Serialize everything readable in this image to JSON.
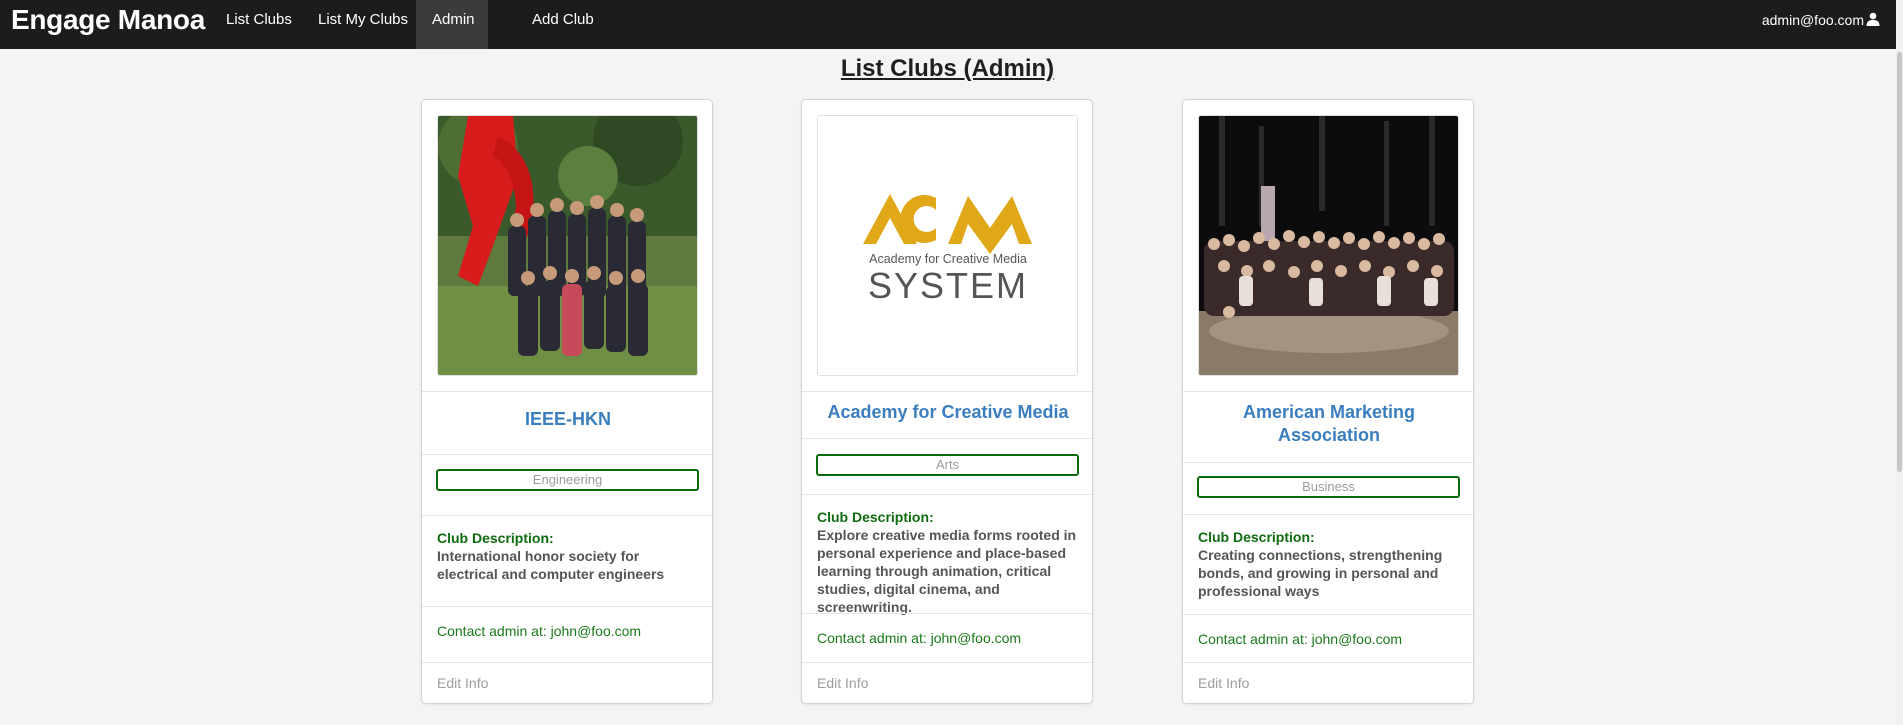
{
  "nav": {
    "brand": "Engage Manoa",
    "items": [
      {
        "label": "List Clubs",
        "active": false
      },
      {
        "label": "List My Clubs",
        "active": false
      },
      {
        "label": "Admin",
        "active": true
      },
      {
        "label": "Add Club",
        "active": false
      }
    ],
    "user": "admin@foo.com",
    "user_icon": "user-icon"
  },
  "page_title": "List Clubs (Admin)",
  "cards": [
    {
      "title": "IEEE-HKN",
      "image": "group-photo-red-sculpture",
      "tag": "Engineering",
      "desc_label": "Club Description:",
      "desc": "International honor society for electrical and computer engineers",
      "contact": "Contact admin at: john@foo.com",
      "edit": "Edit Info"
    },
    {
      "title": "Academy for Creative Media",
      "image": "acm-logo",
      "logo_text_top": "Academy for Creative Media",
      "logo_text_bottom": "SYSTEM",
      "tag": "Arts",
      "desc_label": "Club Description:",
      "desc": "Explore creative media forms rooted in personal experience and place-based learning through animation, critical studies, digital cinema, and screenwriting.",
      "contact": "Contact admin at: john@foo.com",
      "edit": "Edit Info"
    },
    {
      "title": "American Marketing Association",
      "image": "group-photo-night",
      "tag": "Business",
      "desc_label": "Club Description:",
      "desc": "Creating connections, strengthening bonds, and growing in personal and professional ways",
      "contact": "Contact admin at: john@foo.com",
      "edit": "Edit Info"
    }
  ],
  "colors": {
    "navbar": "#1b1c1d",
    "title_blue": "#3a7ec0",
    "green": "#0f6b0f",
    "acm_gold": "#e0a818"
  }
}
